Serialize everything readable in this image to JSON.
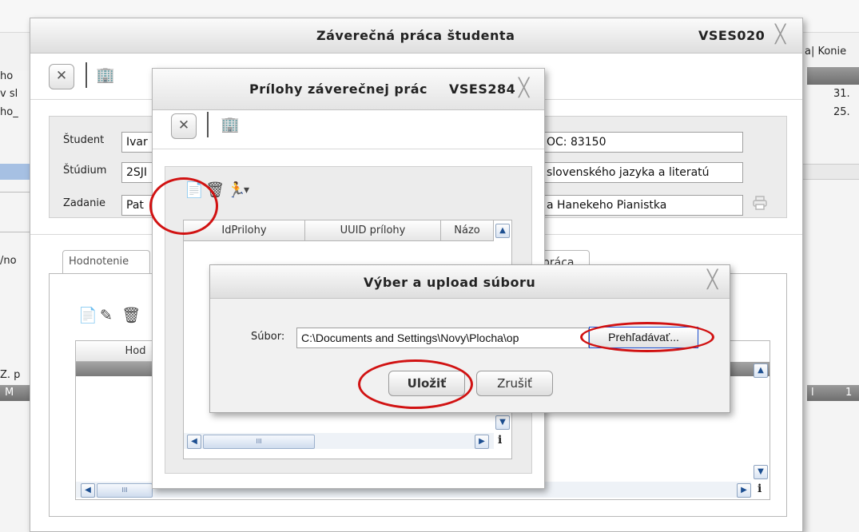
{
  "background": {
    "left_fragments": [
      "ho",
      "v sl",
      "ho_",
      "/no",
      "Z. p",
      "M"
    ],
    "right_header": "a| Konie",
    "right_values": [
      "31.",
      "25."
    ],
    "right_bottom": [
      "l",
      "1"
    ]
  },
  "main_window": {
    "title": "Záverečná práca študenta",
    "code": "VSES020",
    "close_icon": "╳",
    "close_button_icon": "✕",
    "tree_icon": "🏢",
    "labels": {
      "student": "Študent",
      "study": "Štúdium",
      "assignment": "Zadanie"
    },
    "fields_left": {
      "student": "Ivar",
      "study": "2SJI",
      "assignment": "Pat"
    },
    "fields_right": {
      "student": "OC: 83150",
      "study": "slovenského jazyka a literatú",
      "assignment": "a Hanekeho Pianistka"
    },
    "tabs": [
      "Hodnotenie",
      "práca"
    ],
    "grid": {
      "column": "Hod"
    },
    "toolbar_icons": [
      "📄",
      "✎",
      "🗑"
    ]
  },
  "attachments_window": {
    "title": "Prílohy záverečnej prác",
    "code": "VSES284",
    "close_icon": "╳",
    "close_button_icon": "✕",
    "tree_icon": "🏢",
    "toolbar_icons": [
      "📄",
      "🗑",
      "🏃",
      "▾"
    ],
    "columns": [
      "IdPrilohy",
      "UUID prílohy",
      "Názo"
    ]
  },
  "upload_dialog": {
    "title": "Výber a upload súboru",
    "close_icon": "╳",
    "file_label": "Súbor:",
    "file_value": "C:\\Documents and Settings\\Novy\\Plocha\\op",
    "browse_button": "Prehľadávať...",
    "save_button": "Uložiť",
    "cancel_button": "Zrušiť"
  },
  "scroll": {
    "left": "◀",
    "right": "▶",
    "up": "▲",
    "down": "▼",
    "grip": "III",
    "info": "i"
  },
  "annotations": {
    "ring_color": "#d11212"
  }
}
